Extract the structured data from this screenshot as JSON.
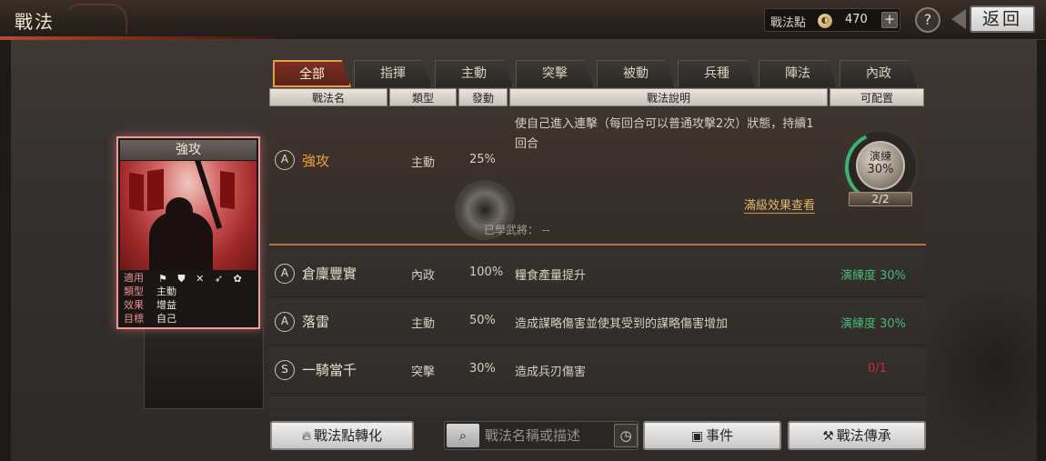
{
  "header": {
    "title": "戰法",
    "points_label": "戰法點",
    "points_icon": "coin-icon",
    "points_value": "470",
    "plus_label": "+",
    "help_label": "?",
    "back_label": "返回"
  },
  "tabs": [
    {
      "label": "全部",
      "active": true
    },
    {
      "label": "指揮",
      "active": false
    },
    {
      "label": "主動",
      "active": false
    },
    {
      "label": "突擊",
      "active": false
    },
    {
      "label": "被動",
      "active": false
    },
    {
      "label": "兵種",
      "active": false
    },
    {
      "label": "陣法",
      "active": false
    },
    {
      "label": "內政",
      "active": false
    }
  ],
  "columns": [
    "戰法名",
    "類型",
    "發動",
    "戰法說明",
    "可配置"
  ],
  "selected": {
    "grade": "A",
    "name": "強攻",
    "type": "主動",
    "rate": "25%",
    "description": "使自己進入連擊（每回合可以普通攻擊2次）狀態，持續1回合",
    "detail_link": "滿級效果查看",
    "learned": "已學武將：  --",
    "practice_label": "演練",
    "practice_pct": "30%",
    "practice_count": "2/2"
  },
  "rows": [
    {
      "grade": "A",
      "name": "倉廩豐實",
      "type": "內政",
      "rate": "100%",
      "description": "糧食產量提升",
      "proficiency": "演練度 30%",
      "status": "green"
    },
    {
      "grade": "A",
      "name": "落雷",
      "type": "主動",
      "rate": "50%",
      "description": "造成謀略傷害並使其受到的謀略傷害增加",
      "proficiency": "演練度 30%",
      "status": "green"
    },
    {
      "grade": "S",
      "name": "一騎當千",
      "type": "突擊",
      "rate": "30%",
      "description": "造成兵刃傷害",
      "proficiency": "0/1",
      "status": "red"
    }
  ],
  "card": {
    "name": "強攻",
    "apply_key": "適用",
    "apply_icons": "⚑ ⛊ ✕ ➶ ✿",
    "type_key": "類型",
    "type_val": "主動",
    "effect_key": "效果",
    "effect_val": "增益",
    "target_key": "目標",
    "target_val": "自己"
  },
  "bottom": {
    "convert_label": "戰法點轉化",
    "search_placeholder": "戰法名稱或描述",
    "event_label": "事件",
    "inherit_label": "戰法傳承"
  },
  "colors": {
    "accent_orange": "#e89a4e",
    "selected_name": "#f0a040",
    "proficiency_green": "#4ab878",
    "proficiency_red": "#d02a2a",
    "card_glow": "#f09a9a"
  }
}
